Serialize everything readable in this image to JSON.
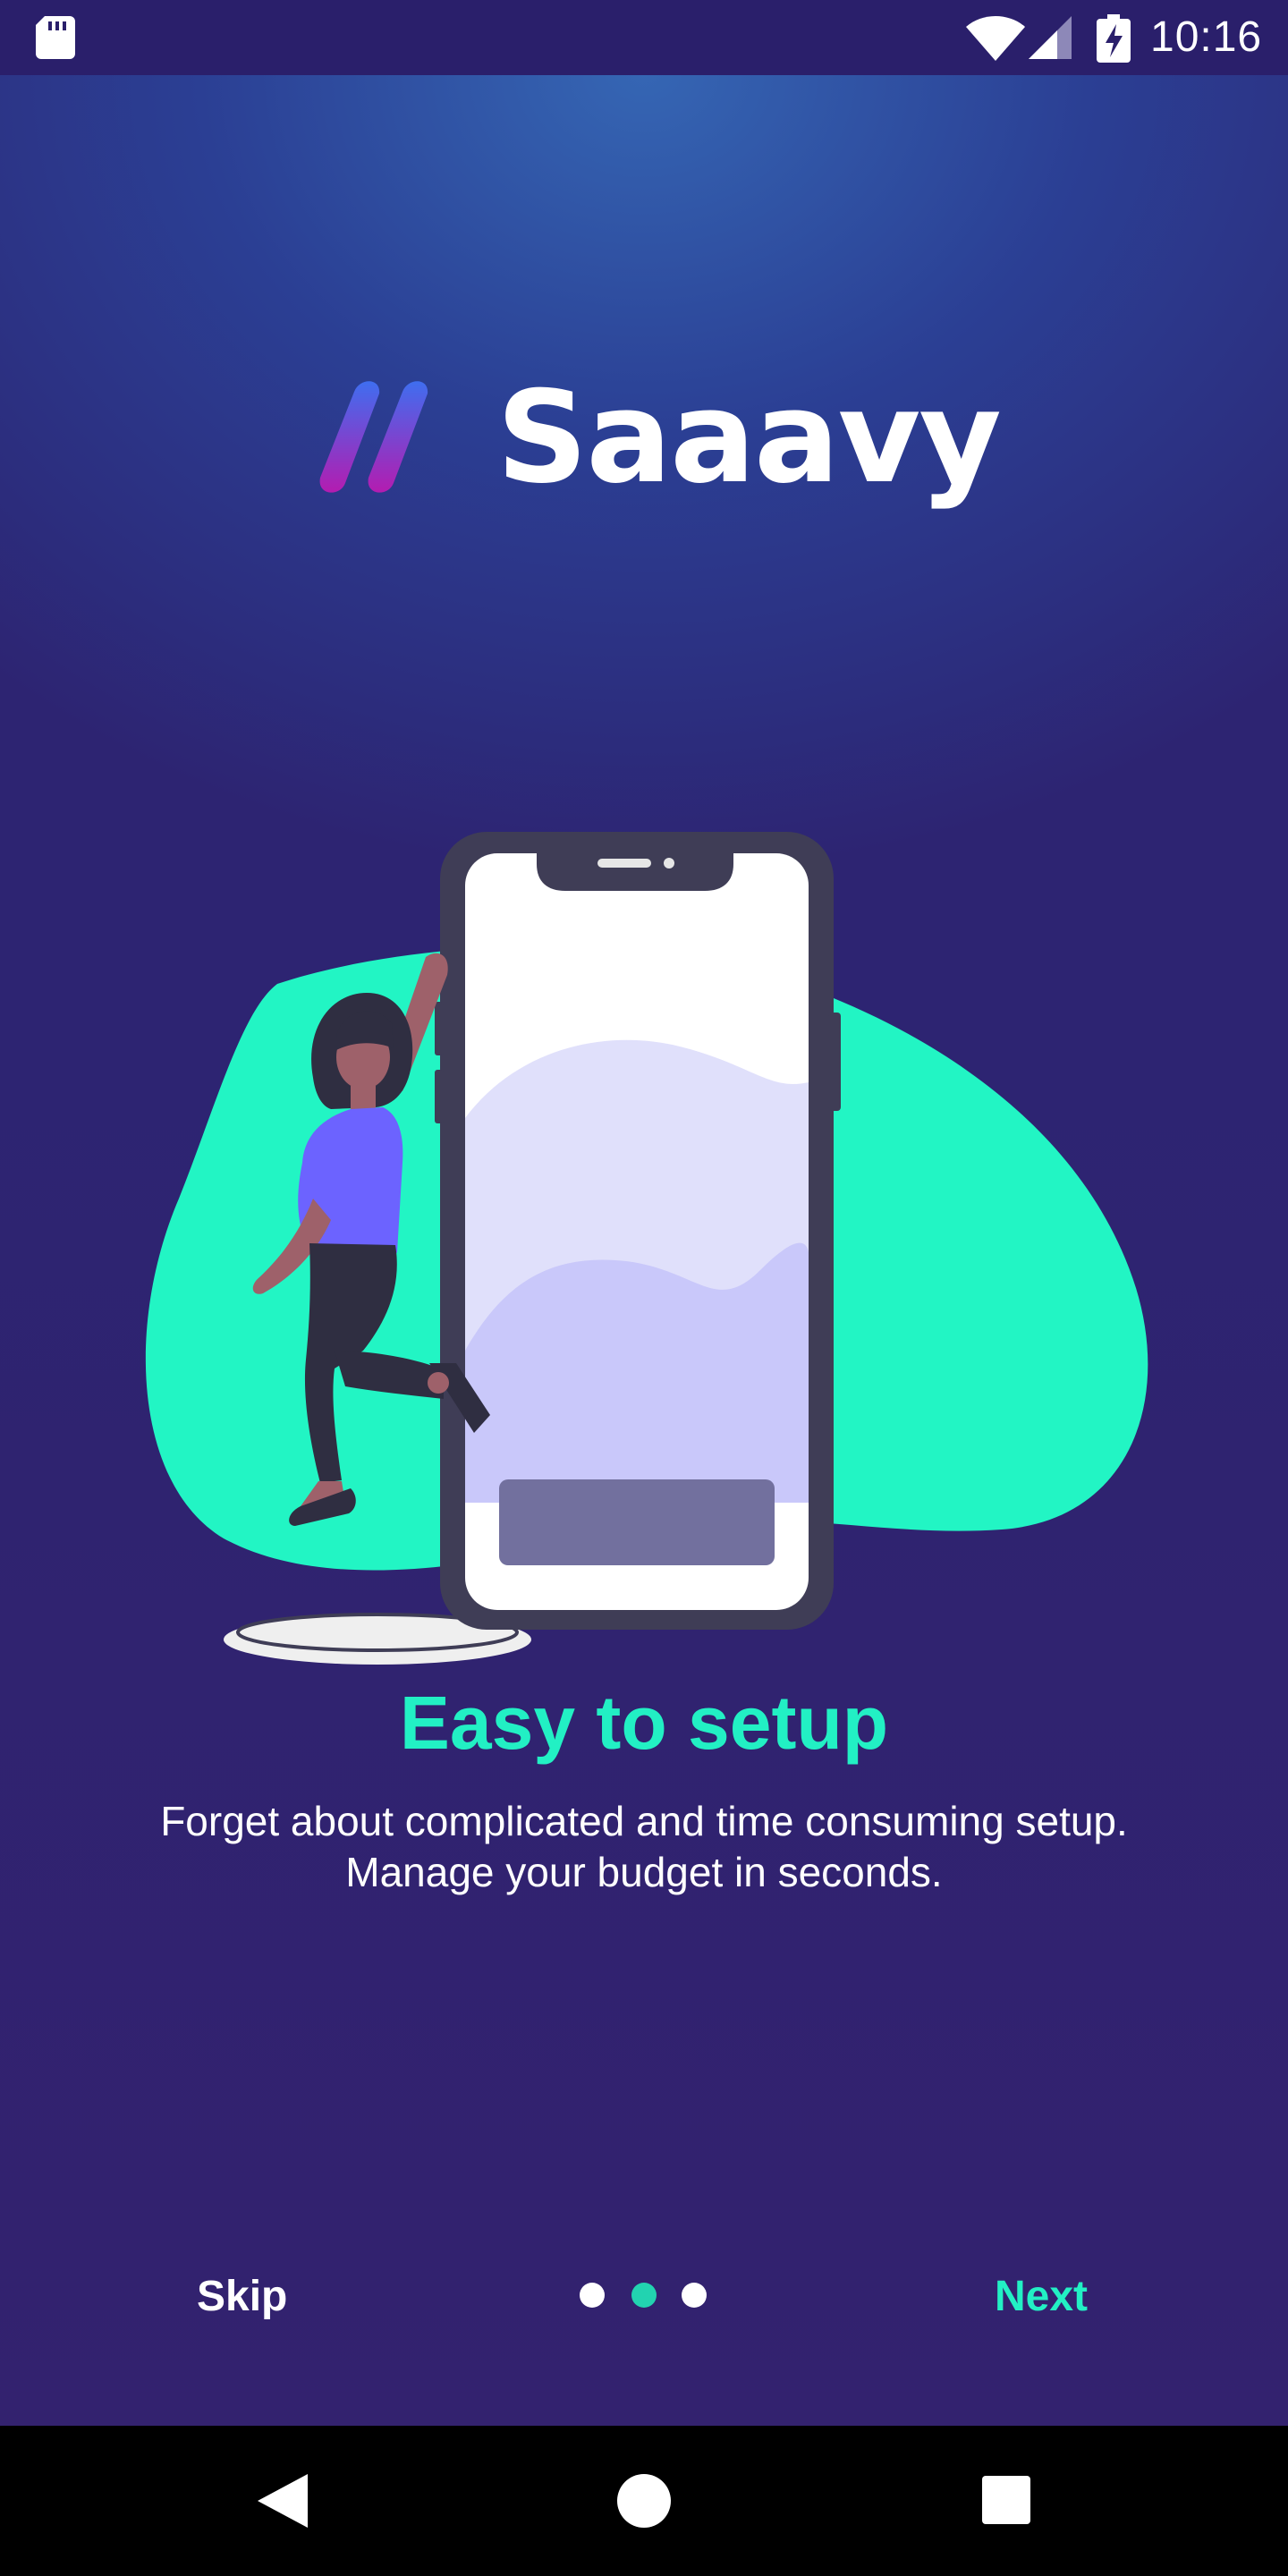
{
  "status_bar": {
    "time": "10:16",
    "icons": [
      "sd-card-icon",
      "wifi-icon",
      "cell-signal-icon",
      "battery-charging-icon"
    ]
  },
  "brand": {
    "name": "Saaavy",
    "logo_icon": "saaavy-logo-icon"
  },
  "onboarding": {
    "illustration": "woman-leaning-on-phone-illustration",
    "title": "Easy to setup",
    "description": "Forget about complicated and time consuming setup. Manage your budget in seconds.",
    "page_indicator": {
      "total": 3,
      "current": 2
    }
  },
  "footer": {
    "skip_label": "Skip",
    "next_label": "Next"
  },
  "colors": {
    "accent": "#22f0c4",
    "background_top": "#3566b4",
    "background_bottom": "#2e2370",
    "blob": "#22f5c4",
    "shirt": "#6c63ff"
  },
  "nav_bar": {
    "icons": [
      "back-icon",
      "home-icon",
      "recent-apps-icon"
    ]
  }
}
